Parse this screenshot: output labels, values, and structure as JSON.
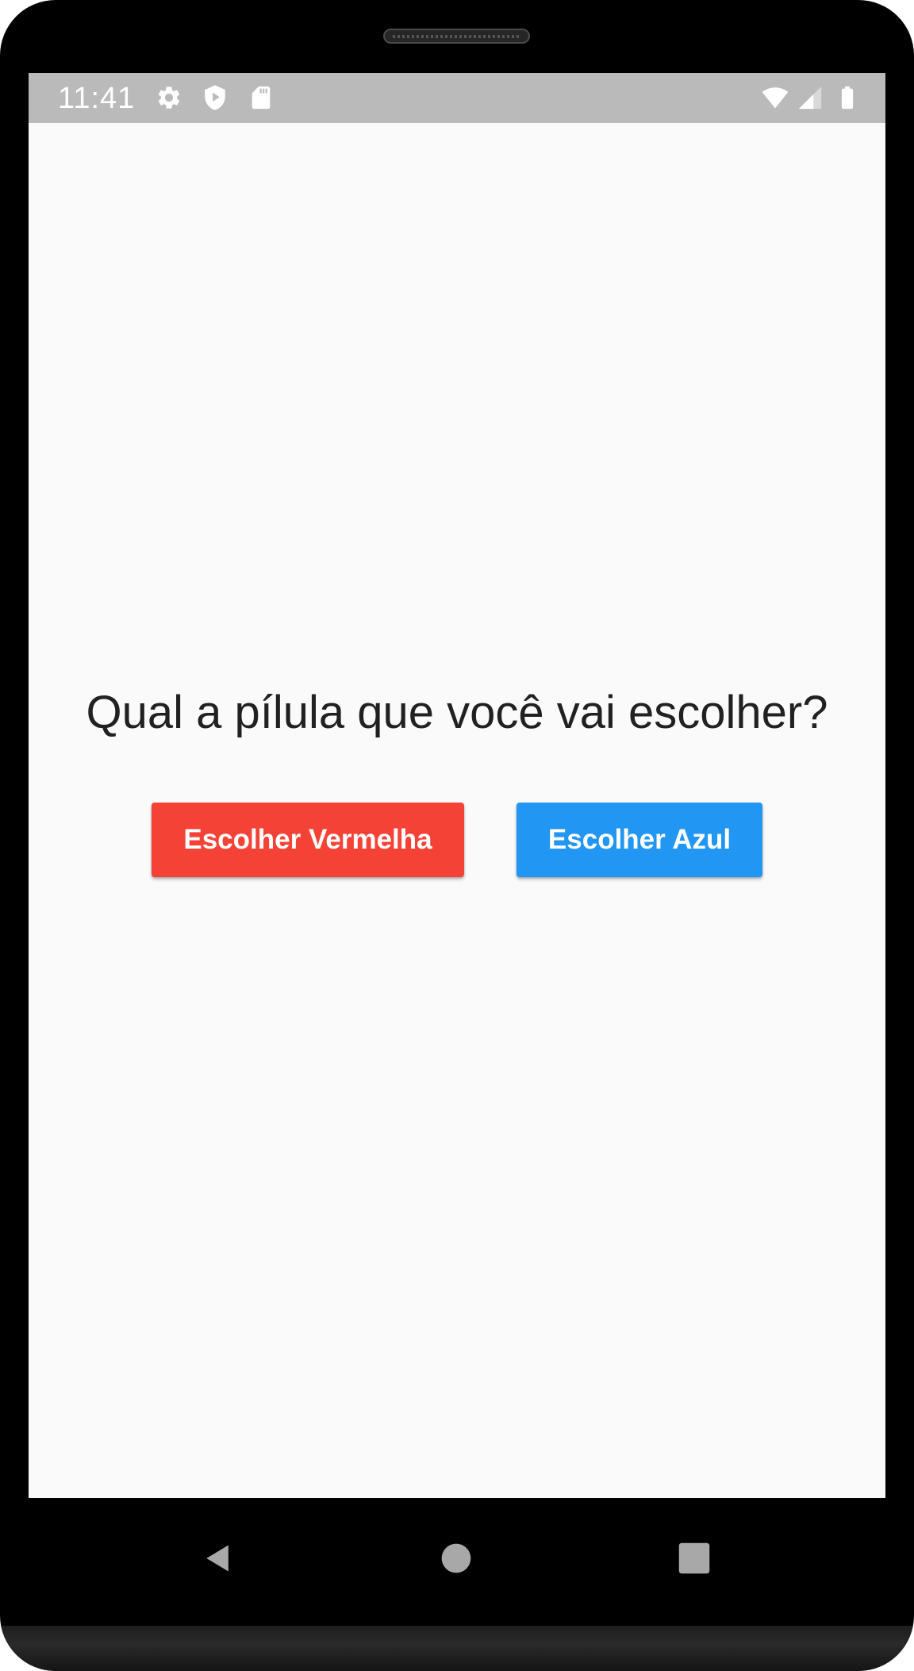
{
  "status_bar": {
    "time": "11:41",
    "left_icons": [
      "gear-icon",
      "shield-play-icon",
      "sd-card-icon"
    ],
    "right_icons": [
      "wifi-icon",
      "signal-icon",
      "battery-icon"
    ],
    "background_color": "#bababa"
  },
  "app": {
    "question": "Qual a pílula que você vai escolher?",
    "buttons": {
      "red": {
        "label": "Escolher Vermelha",
        "color": "#f44336"
      },
      "blue": {
        "label": "Escolher Azul",
        "color": "#2196f3"
      }
    },
    "background_color": "#fafafa"
  },
  "navigation_bar": {
    "buttons": [
      "back-icon",
      "home-icon",
      "recents-icon"
    ]
  }
}
